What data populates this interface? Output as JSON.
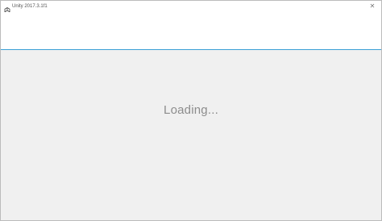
{
  "window": {
    "title": "Unity 2017.3.1f1",
    "close_glyph": "✕",
    "icon": "unity-logo-icon"
  },
  "colors": {
    "accent_line": "#3b9fd6",
    "content_background": "#f0f0f0",
    "loading_text": "#8c8c8c"
  },
  "main": {
    "loading_label": "Loading..."
  }
}
